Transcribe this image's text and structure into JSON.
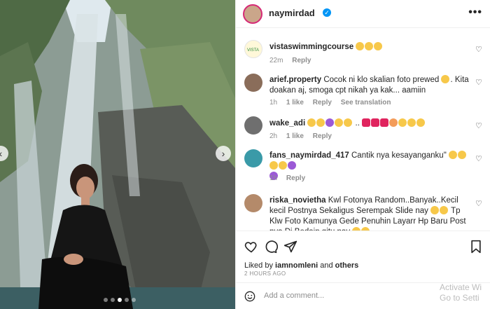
{
  "post": {
    "username": "naymirdad",
    "verified_label": "✓",
    "more_label": "•••",
    "carousel_dots": 5,
    "active_dot": 2
  },
  "comments": [
    {
      "user": "vistaswimmingcourse",
      "text": "",
      "emoji": [
        "😍",
        "😍",
        "😍"
      ],
      "time": "22m",
      "likes": "",
      "reply": "Reply",
      "avatar_color": "#fff8d9"
    },
    {
      "user": "arief.property",
      "text": "Cocok ni klo skalian foto prewed",
      "text2": ". Kita doakan aj, smoga cpt nikah ya kak... aamiin",
      "time": "1h",
      "likes": "1 like",
      "reply": "Reply",
      "translation": "See translation",
      "avatar_color": "#8a6d5a"
    },
    {
      "user": "wake_adi",
      "text": " ..",
      "time": "2h",
      "likes": "1 like",
      "reply": "Reply",
      "avatar_color": "#6f6f6f"
    },
    {
      "user": "fans_naymirdad_417",
      "text": "Cantik nya kesayanganku\"",
      "time": "1h",
      "likes": "",
      "reply": "Reply",
      "avatar_color": "#3a9aa8"
    },
    {
      "user": "riska_novietha",
      "text": "Kwl Fotonya Random..Banyak..Kecil kecil Postnya Sekaligus Serempak Slide nay",
      "text2": " Tp Klw Foto Kamunya Gede Penuhin Layarr Hp Baru Post nya Di Bedain gitu nay",
      "time": "",
      "likes": "",
      "reply": "",
      "avatar_color": "#b48a6a"
    }
  ],
  "footer": {
    "liked_by_prefix": "Liked by",
    "liked_by_user": "iamnomleni",
    "liked_by_and": "and",
    "liked_by_others": "others",
    "time_ago": "2 HOURS AGO",
    "add_comment_placeholder": "Add a comment..."
  },
  "overlay": {
    "activate_text": "Activate Wi",
    "activate_text2": "Go to Setti"
  },
  "icons": {
    "like": "heart-icon",
    "comment": "comment-icon",
    "share": "share-icon",
    "save": "bookmark-icon",
    "emoji": "smiley-icon",
    "prev": "chevron-left-icon",
    "next": "chevron-right-icon"
  },
  "colors": {
    "verified": "#0095f6",
    "story_ring": "#d62976",
    "meta_text": "#8e8e8e"
  }
}
